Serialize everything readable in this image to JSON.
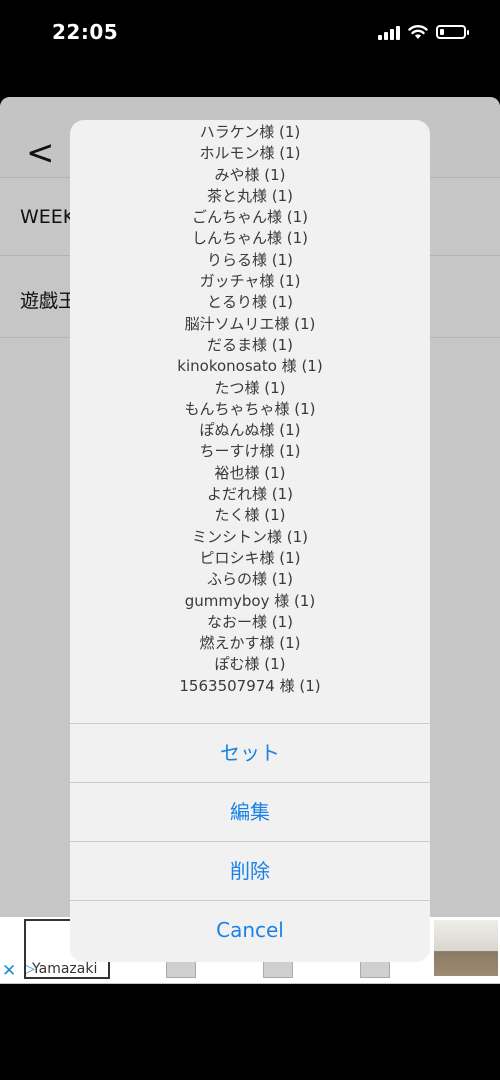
{
  "status_bar": {
    "time": "22:05",
    "battery_level": 0.2
  },
  "app": {
    "back_label": "<",
    "rows": [
      "WEEK",
      "遊戯王"
    ]
  },
  "ad": {
    "close_label": "✕",
    "play_label": "▷",
    "brand": "Yamazaki"
  },
  "sheet": {
    "message_lines": [
      "ハラケン様 (1)",
      "ホルモン様 (1)",
      "みや様 (1)",
      "茶と丸様 (1)",
      "ごんちゃん様 (1)",
      "しんちゃん様 (1)",
      "りらる様 (1)",
      "ガッチャ様 (1)",
      "とるり様 (1)",
      "脳汁ソムリエ様 (1)",
      "だるま様 (1)",
      "kinokonosato 様 (1)",
      "たつ様 (1)",
      "もんちゃちゃ様 (1)",
      "ぽぬんぬ様 (1)",
      "ちーすけ様 (1)",
      "裕也様 (1)",
      "よだれ様 (1)",
      "たく様 (1)",
      "ミンシトン様 (1)",
      "ピロシキ様 (1)",
      "ふらの様 (1)",
      "gummyboy 様 (1)",
      "なおー様 (1)",
      "燃えかす様 (1)",
      "ぽむ様 (1)",
      "1563507974 様 (1)"
    ],
    "actions": {
      "set": "セット",
      "edit": "編集",
      "delete": "削除",
      "cancel": "Cancel"
    }
  },
  "colors": {
    "accent": "#1a82e6",
    "dim_background": "#c6c6c6",
    "sheet_background": "#f1f1f1"
  }
}
